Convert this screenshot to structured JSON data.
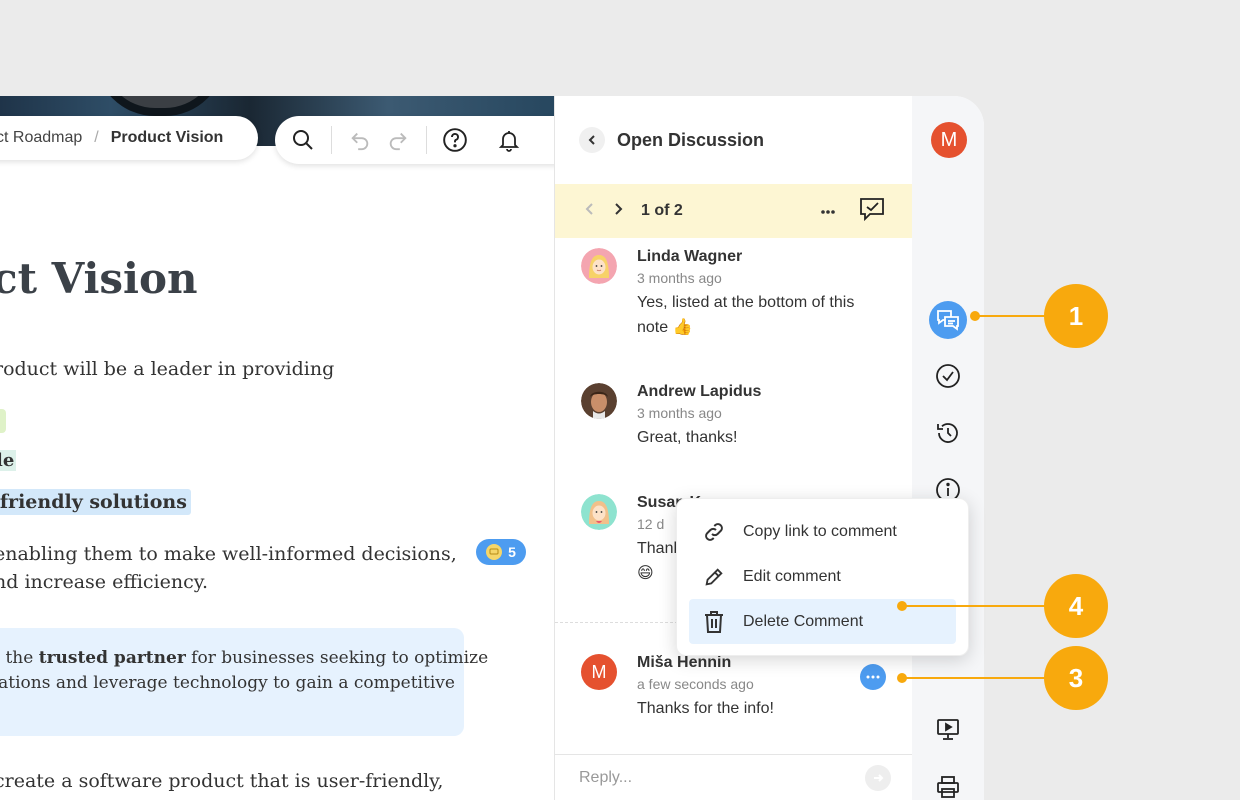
{
  "breadcrumb": {
    "parent": "ct Roadmap",
    "separator": "/",
    "current": "Product Vision"
  },
  "document": {
    "title": "ct Vision",
    "paragraph1": "roduct will be a leader in providing",
    "highlight_mint": "le",
    "highlight_blue": "-friendly solutions",
    "paragraph2_line1": "enabling them to make well-informed decisions,",
    "paragraph2_line2": "nd increase efficiency.",
    "comment_badge_count": "5",
    "quote_line1_pre": "e the ",
    "quote_line1_bold": "trusted partner",
    "quote_line1_post": " for businesses seeking to optimize",
    "quote_line2": "rations and leverage technology to gain a competitive",
    "paragraph3": " create a software product that is user-friendly,"
  },
  "panel": {
    "title": "Open Discussion",
    "thread_counter": "1 of 2",
    "comments": [
      {
        "name": "Linda Wagner",
        "time": "3 months ago",
        "text_line1": "Yes, listed at the bottom of this",
        "text_line2": "note 👍"
      },
      {
        "name": "Andrew Lapidus",
        "time": "3 months ago",
        "text_line1": "Great, thanks!"
      },
      {
        "name": "Susan K",
        "time": "12 d",
        "text_line1": "Thank",
        "text_line2": "😄"
      },
      {
        "name": "Miša Hennin",
        "time": "a few seconds ago",
        "text_line1": "Thanks for the info!",
        "avatar_initial": "M"
      }
    ],
    "reply_placeholder": "Reply..."
  },
  "menu": {
    "items": [
      {
        "label": "Copy link to comment"
      },
      {
        "label": "Edit comment"
      },
      {
        "label": "Delete Comment"
      }
    ]
  },
  "sidebar": {
    "user_initial": "M"
  },
  "callouts": [
    "1",
    "4",
    "3"
  ],
  "colors": {
    "accent": "#4d9cf0",
    "callout": "#f8a90d",
    "avatar": "#e5512f",
    "thread_bar": "#fdf6d3"
  }
}
